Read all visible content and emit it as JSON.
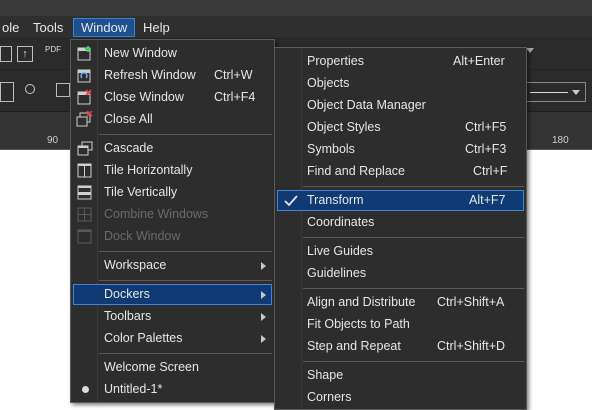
{
  "menubar": {
    "items": [
      "ole",
      "Tools",
      "Window",
      "Help"
    ]
  },
  "ruler": {
    "labels": [
      "90",
      "180"
    ]
  },
  "toolbar": {
    "pdf_label": "PDF"
  },
  "window_menu": {
    "items": [
      {
        "label": "New Window",
        "shortcut": ""
      },
      {
        "label": "Refresh Window",
        "shortcut": "Ctrl+W"
      },
      {
        "label": "Close Window",
        "shortcut": "Ctrl+F4"
      },
      {
        "label": "Close All",
        "shortcut": ""
      },
      {
        "label": "Cascade",
        "shortcut": ""
      },
      {
        "label": "Tile Horizontally",
        "shortcut": ""
      },
      {
        "label": "Tile Vertically",
        "shortcut": ""
      },
      {
        "label": "Combine Windows",
        "shortcut": ""
      },
      {
        "label": "Dock Window",
        "shortcut": ""
      },
      {
        "label": "Workspace",
        "shortcut": ""
      },
      {
        "label": "Dockers",
        "shortcut": ""
      },
      {
        "label": "Toolbars",
        "shortcut": ""
      },
      {
        "label": "Color Palettes",
        "shortcut": ""
      },
      {
        "label": "Welcome Screen",
        "shortcut": ""
      },
      {
        "label": "Untitled-1*",
        "shortcut": ""
      }
    ]
  },
  "dockers_menu": {
    "items": [
      {
        "label": "Properties",
        "shortcut": "Alt+Enter"
      },
      {
        "label": "Objects",
        "shortcut": ""
      },
      {
        "label": "Object Data Manager",
        "shortcut": ""
      },
      {
        "label": "Object Styles",
        "shortcut": "Ctrl+F5"
      },
      {
        "label": "Symbols",
        "shortcut": "Ctrl+F3"
      },
      {
        "label": "Find and Replace",
        "shortcut": "Ctrl+F"
      },
      {
        "label": "Transform",
        "shortcut": "Alt+F7"
      },
      {
        "label": "Coordinates",
        "shortcut": ""
      },
      {
        "label": "Live Guides",
        "shortcut": ""
      },
      {
        "label": "Guidelines",
        "shortcut": ""
      },
      {
        "label": "Align and Distribute",
        "shortcut": "Ctrl+Shift+A"
      },
      {
        "label": "Fit Objects to Path",
        "shortcut": ""
      },
      {
        "label": "Step and Repeat",
        "shortcut": "Ctrl+Shift+D"
      },
      {
        "label": "Shape",
        "shortcut": ""
      },
      {
        "label": "Corners",
        "shortcut": ""
      }
    ]
  },
  "colors": {
    "highlight": "#0f3a74",
    "highlight_border": "#3f86d8",
    "menu_bg": "#2d2d2d"
  }
}
